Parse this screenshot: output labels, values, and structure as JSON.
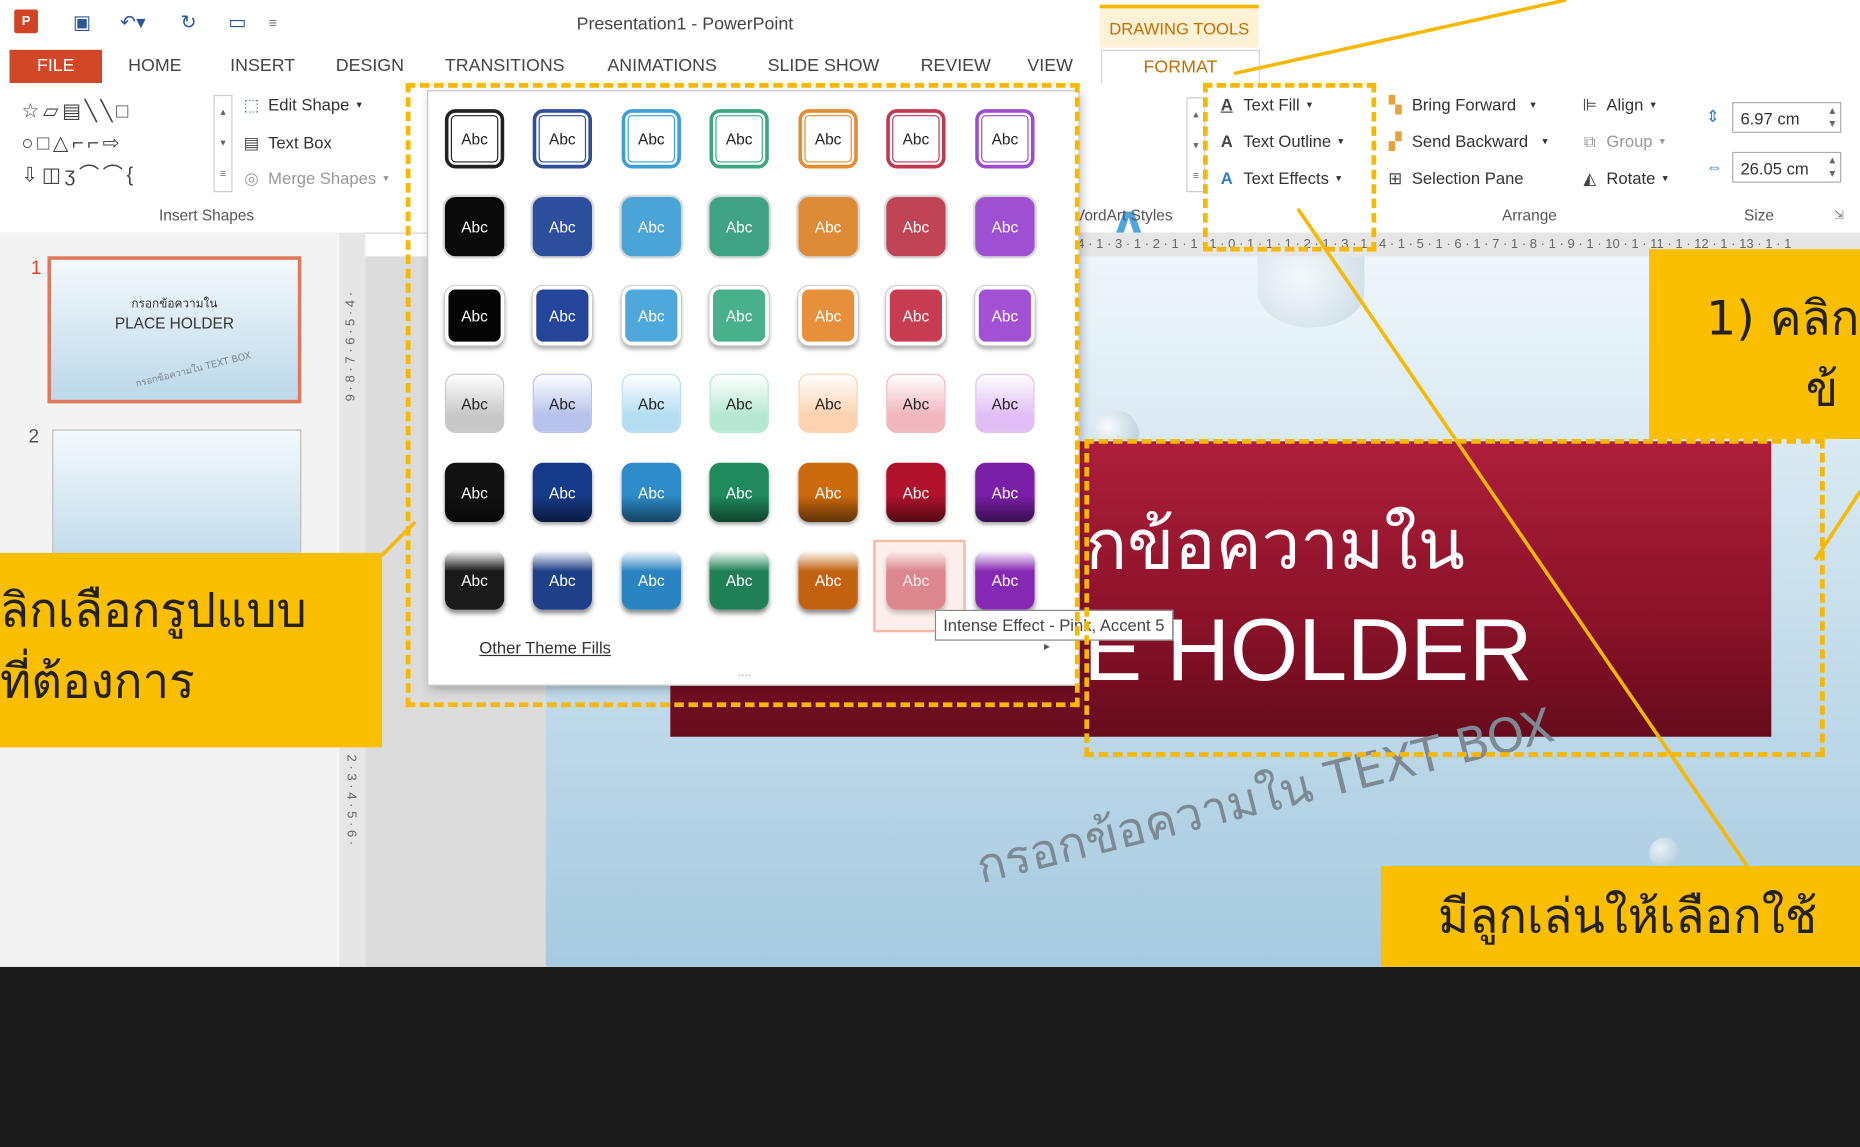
{
  "window": {
    "title": "Presentation1 - PowerPoint",
    "contextual_group": "DRAWING TOOLS",
    "app_icon": "P"
  },
  "tabs": [
    "FILE",
    "HOME",
    "INSERT",
    "DESIGN",
    "TRANSITIONS",
    "ANIMATIONS",
    "SLIDE SHOW",
    "REVIEW",
    "VIEW",
    "FORMAT"
  ],
  "ribbon": {
    "insert_shapes": {
      "edit_shape": "Edit Shape",
      "text_box": "Text Box",
      "merge_shapes": "Merge Shapes",
      "label": "Insert Shapes",
      "shape_glyphs": [
        "☆",
        "▱",
        "▤",
        "╲",
        "╲",
        "□",
        "○",
        "□",
        "△",
        "⌐",
        "⌐",
        "⇨",
        "⇩",
        "◫",
        "ʒ",
        "⌒",
        "⌒",
        "{"
      ]
    },
    "wordart": {
      "label": "VordArt Styles"
    },
    "text": {
      "fill": "Text Fill",
      "outline": "Text Outline",
      "effects": "Text Effects"
    },
    "arrange": {
      "bring_forward": "Bring Forward",
      "send_backward": "Send Backward",
      "selection_pane": "Selection Pane",
      "align": "Align",
      "group": "Group",
      "rotate": "Rotate",
      "label": "Arrange"
    },
    "size": {
      "height": "6.97 cm",
      "width": "26.05 cm",
      "label": "Size"
    }
  },
  "ruler_text": "4 · 1 · 3 · 1 · 2 · 1 · 1 · 1 · 0 · 1 · 1 · 1 · 2 · 1 · 3 · 1 · 4 · 1 · 5 · 1 · 6 · 1 · 7 · 1 · 8 · 1 · 9 · 1 · 10 · 1 · 11 · 1 · 12 · 1 · 13 · 1 · 1",
  "vertical_ruler_text": "9 · 8 · 7 · 6 · 5 · 4 ·",
  "vertical_ruler_text_lower": "2 · 3 · 4 · 5 · 6 ·",
  "thumbnails": [
    {
      "number": "1",
      "line1": "กรอกข้อความใน",
      "line2": "PLACE HOLDER",
      "line3": "กรอกข้อความใน TEXT BOX"
    },
    {
      "number": "2"
    }
  ],
  "gallery": {
    "swatch_text": "Abc",
    "rows": [
      {
        "style": "outline",
        "colors": [
          "#222222",
          "#2e4e9a",
          "#3d9fd8",
          "#3aa77e",
          "#e48c2e",
          "#c0394f",
          "#9d4dd1"
        ]
      },
      {
        "style": "subtle_dark",
        "colors": [
          "#0a0a0a",
          "#2d4f9e",
          "#4aa5d6",
          "#3fa383",
          "#dd8b36",
          "#c04456",
          "#9e4fd2"
        ]
      },
      {
        "style": "moderate",
        "colors": [
          "#050505",
          "#25459a",
          "#4fa8db",
          "#48b08a",
          "#e7903c",
          "#c83c52",
          "#a351d4"
        ]
      },
      {
        "style": "light",
        "colors": [
          "#c8c8c8",
          "#b7c3ec",
          "#b6def3",
          "#b7e8d3",
          "#fcd2b0",
          "#f2b6bf",
          "#e1bdf5"
        ]
      },
      {
        "style": "dark_gradient",
        "colors": [
          "#111111",
          "#163a8a",
          "#2d8cc9",
          "#1f8b5d",
          "#cc6a0e",
          "#b0122b",
          "#7a1fa8"
        ]
      },
      {
        "style": "intense",
        "colors": [
          "#1a1a1a",
          "#1f3f88",
          "#2b84c2",
          "#1f8056",
          "#c26210",
          "#b51630",
          "#8728b4"
        ]
      }
    ],
    "other_theme_fills": "Other Theme Fills",
    "more_indicator": "....",
    "tooltip": "Intense Effect - Pink, Accent 5"
  },
  "slide": {
    "placeholder_line1": "กข้อความใน",
    "placeholder_line2": "PLACE HOLDER",
    "textbox_text": "กรอกข้อความใน TEXT BOX",
    "placeholder_color": "#9a1530"
  },
  "annotations": {
    "callout_left": [
      "ลิกเลือกรูปแบบ",
      "ที่ต้องการ"
    ],
    "callout_right_top": [
      "1) คลิก",
      "ข้"
    ],
    "callout_bottom": "มีลูกเล่นให้เลือกใช้",
    "accent_color": "#f6b800"
  }
}
